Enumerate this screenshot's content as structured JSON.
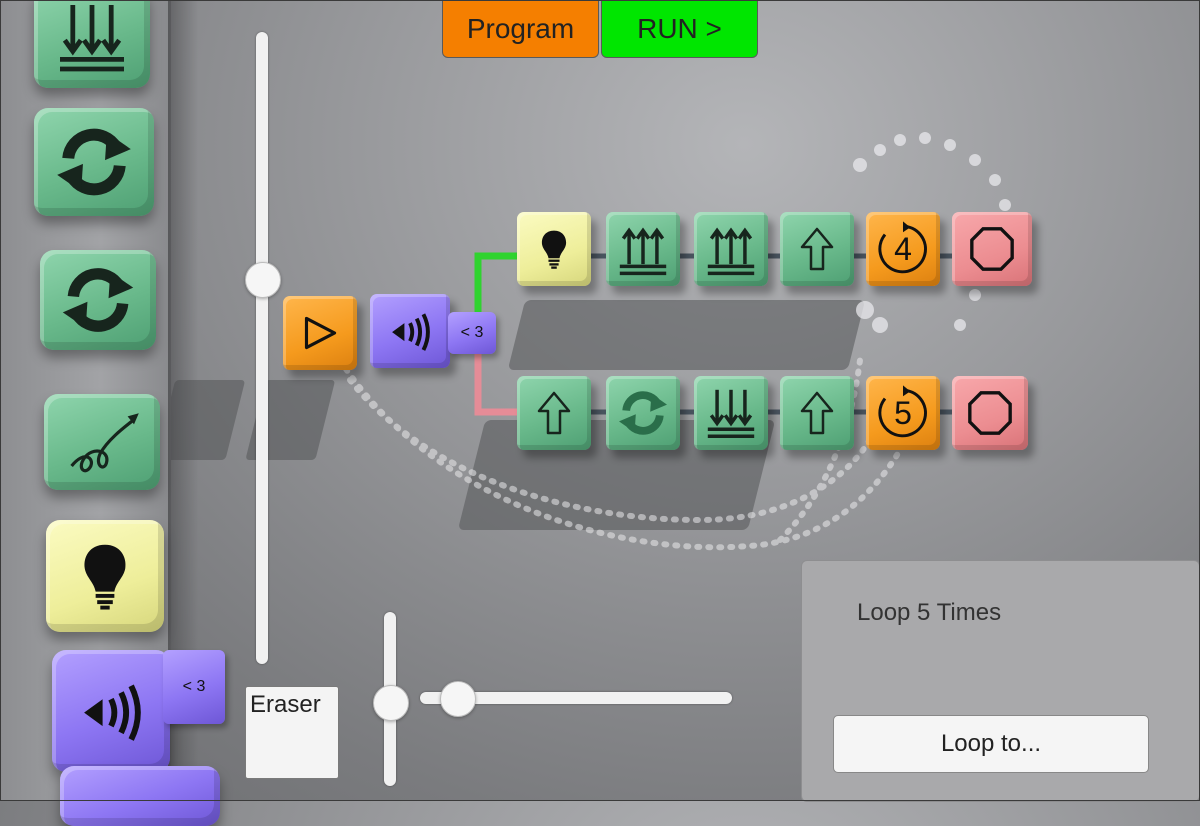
{
  "toolbar": {
    "program_label": "Program",
    "run_label": "RUN >"
  },
  "palette": {
    "items": [
      {
        "icon": "down-arrows-icon"
      },
      {
        "icon": "rotate-icon"
      },
      {
        "icon": "rotate-icon"
      },
      {
        "icon": "loop-curve-icon"
      },
      {
        "icon": "lightbulb-icon"
      },
      {
        "icon": "sound-sensor-icon",
        "condition_label": "< 3"
      }
    ]
  },
  "program": {
    "start_block": {
      "icon": "play-icon"
    },
    "sensor_block": {
      "icon": "sound-sensor-icon",
      "condition_label": "< 3"
    },
    "top_branch": {
      "connector_color": "#2fd32f",
      "blocks": [
        "lightbulb-icon",
        "up-arrows-icon",
        "up-arrows-icon",
        "up-arrow-icon",
        "loop-count-icon",
        "stop-icon"
      ],
      "loop_count": "4"
    },
    "bottom_branch": {
      "connector_color": "#e58c97",
      "blocks": [
        "up-arrow-icon",
        "rotate-icon",
        "down-arrows-icon",
        "up-arrow-icon",
        "loop-count-icon",
        "stop-icon"
      ],
      "loop_count": "5"
    }
  },
  "tools": {
    "eraser_label": "Eraser"
  },
  "loop_panel": {
    "title": "Loop 5 Times",
    "button_label": "Loop to..."
  },
  "colors": {
    "program_button": "#f57f00",
    "run_button": "#00e600",
    "green_block": "#6fc091",
    "orange_block": "#f59a1d",
    "pink_block": "#ec8d91",
    "purple_block": "#8d76f3",
    "yellow_block": "#eeee9a"
  }
}
